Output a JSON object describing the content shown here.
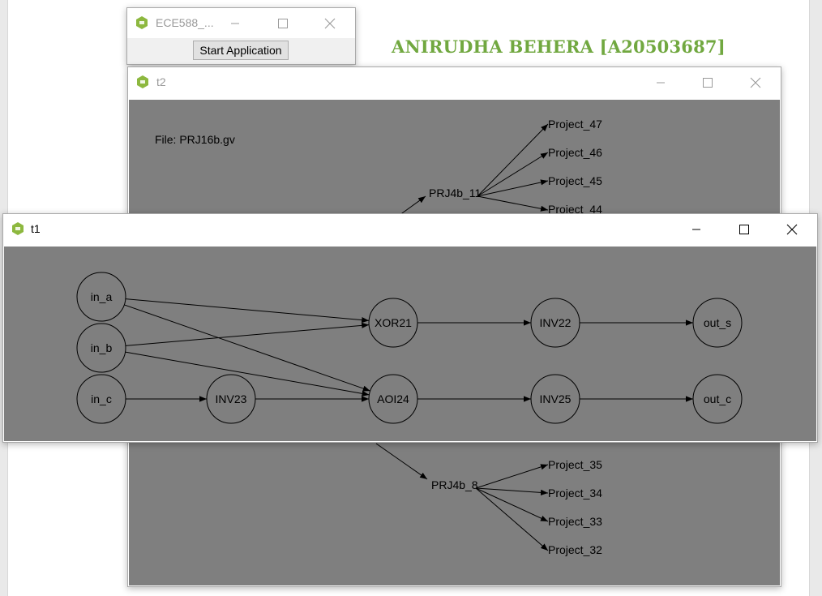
{
  "author_heading": "ANIRUDHA BEHERA [A20503687]",
  "colors": {
    "canvas": "#7f7f7f",
    "author": "#71a840",
    "icon": "#8db83f"
  },
  "main_window": {
    "title": "ECE588_...",
    "start_button": "Start Application"
  },
  "t2_window": {
    "title": "t2",
    "file_label": "File: PRJ16b.gv",
    "nodes": [
      {
        "id": "prj4b_11",
        "label": "PRJ4b_11"
      },
      {
        "id": "p47",
        "label": "Project_47"
      },
      {
        "id": "p46",
        "label": "Project_46"
      },
      {
        "id": "p45",
        "label": "Project_45"
      },
      {
        "id": "p44",
        "label": "Project_44"
      },
      {
        "id": "p_lower",
        "label": "Project_47"
      },
      {
        "id": "prj4b_8",
        "label": "PRJ4b_8"
      },
      {
        "id": "p35",
        "label": "Project_35"
      },
      {
        "id": "p34",
        "label": "Project_34"
      },
      {
        "id": "p33",
        "label": "Project_33"
      },
      {
        "id": "p32",
        "label": "Project_32"
      }
    ]
  },
  "t1_window": {
    "title": "t1",
    "nodes": [
      {
        "id": "in_a",
        "label": "in_a"
      },
      {
        "id": "in_b",
        "label": "in_b"
      },
      {
        "id": "in_c",
        "label": "in_c"
      },
      {
        "id": "xor21",
        "label": "XOR21"
      },
      {
        "id": "aoi24",
        "label": "AOI24"
      },
      {
        "id": "inv23",
        "label": "INV23"
      },
      {
        "id": "inv22",
        "label": "INV22"
      },
      {
        "id": "inv25",
        "label": "INV25"
      },
      {
        "id": "out_s",
        "label": "out_s"
      },
      {
        "id": "out_c",
        "label": "out_c"
      }
    ],
    "edges": [
      [
        "in_a",
        "xor21"
      ],
      [
        "in_a",
        "aoi24"
      ],
      [
        "in_b",
        "xor21"
      ],
      [
        "in_b",
        "aoi24"
      ],
      [
        "in_c",
        "inv23"
      ],
      [
        "inv23",
        "aoi24"
      ],
      [
        "xor21",
        "inv22"
      ],
      [
        "inv22",
        "out_s"
      ],
      [
        "aoi24",
        "inv25"
      ],
      [
        "inv25",
        "out_c"
      ]
    ]
  }
}
